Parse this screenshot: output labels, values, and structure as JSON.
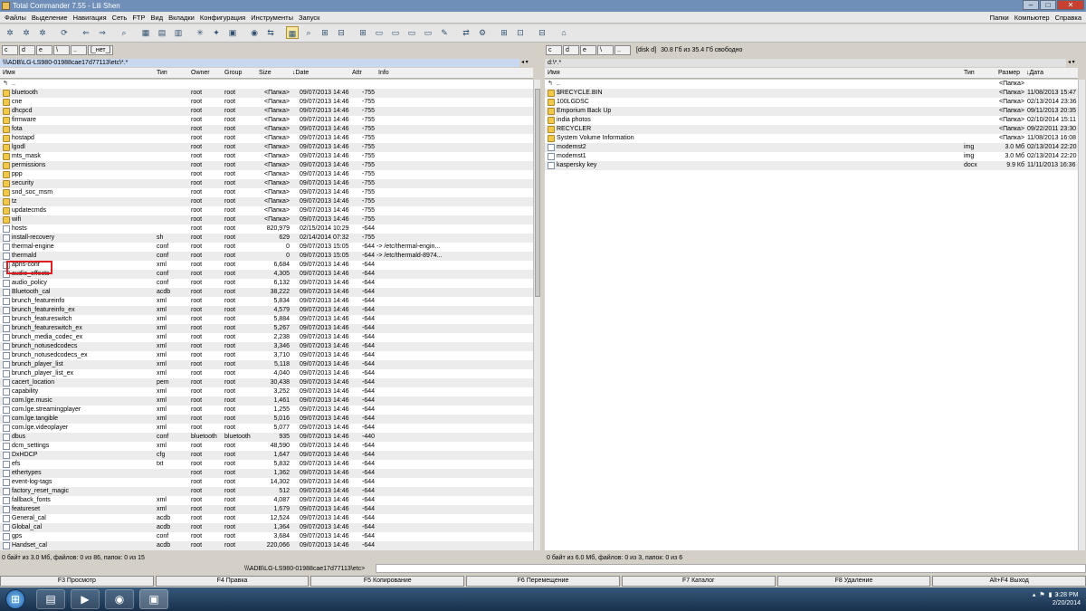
{
  "window": {
    "title": "Total Commander 7.55 - Lili Shen"
  },
  "menu": {
    "left": [
      "Файлы",
      "Выделение",
      "Навигация",
      "Сеть",
      "FTP",
      "Вид",
      "Вкладки",
      "Конфигурация",
      "Инструменты",
      "Запуск"
    ],
    "right": [
      "Папки",
      "Компьютер",
      "Справка"
    ]
  },
  "left": {
    "drives": [
      "c",
      "d",
      "e",
      "\\",
      "..",
      "[_нет_]"
    ],
    "path": "\\\\\\ADB\\LG-LS980-01988cae17d77113\\etc\\*.*",
    "headers": [
      "Имя",
      "Тип",
      "Owner",
      "Group",
      "Size",
      "Date",
      "Attr",
      "Info"
    ],
    "rows": [
      {
        "name": "..",
        "t": "",
        "o": "",
        "g": "",
        "s": "",
        "d": "",
        "a": "",
        "i": "",
        "k": "up"
      },
      {
        "name": "bluetooth",
        "t": "",
        "o": "root",
        "g": "root",
        "s": "<Папка>",
        "d": "09/07/2013 14:46",
        "a": "-755",
        "i": "",
        "k": "folder"
      },
      {
        "name": "cne",
        "t": "",
        "o": "root",
        "g": "root",
        "s": "<Папка>",
        "d": "09/07/2013 14:46",
        "a": "-755",
        "i": "",
        "k": "folder"
      },
      {
        "name": "dhcpcd",
        "t": "",
        "o": "root",
        "g": "root",
        "s": "<Папка>",
        "d": "09/07/2013 14:46",
        "a": "-755",
        "i": "",
        "k": "folder"
      },
      {
        "name": "firmware",
        "t": "",
        "o": "root",
        "g": "root",
        "s": "<Папка>",
        "d": "09/07/2013 14:46",
        "a": "-755",
        "i": "",
        "k": "folder"
      },
      {
        "name": "fota",
        "t": "",
        "o": "root",
        "g": "root",
        "s": "<Папка>",
        "d": "09/07/2013 14:46",
        "a": "-755",
        "i": "",
        "k": "folder"
      },
      {
        "name": "hostapd",
        "t": "",
        "o": "root",
        "g": "root",
        "s": "<Папка>",
        "d": "09/07/2013 14:46",
        "a": "-755",
        "i": "",
        "k": "folder"
      },
      {
        "name": "lgodl",
        "t": "",
        "o": "root",
        "g": "root",
        "s": "<Папка>",
        "d": "09/07/2013 14:46",
        "a": "-755",
        "i": "",
        "k": "folder"
      },
      {
        "name": "mts_mask",
        "t": "",
        "o": "root",
        "g": "root",
        "s": "<Папка>",
        "d": "09/07/2013 14:46",
        "a": "-755",
        "i": "",
        "k": "folder"
      },
      {
        "name": "permissions",
        "t": "",
        "o": "root",
        "g": "root",
        "s": "<Папка>",
        "d": "09/07/2013 14:46",
        "a": "-755",
        "i": "",
        "k": "folder"
      },
      {
        "name": "ppp",
        "t": "",
        "o": "root",
        "g": "root",
        "s": "<Папка>",
        "d": "09/07/2013 14:46",
        "a": "-755",
        "i": "",
        "k": "folder"
      },
      {
        "name": "security",
        "t": "",
        "o": "root",
        "g": "root",
        "s": "<Папка>",
        "d": "09/07/2013 14:46",
        "a": "-755",
        "i": "",
        "k": "folder"
      },
      {
        "name": "snd_soc_msm",
        "t": "",
        "o": "root",
        "g": "root",
        "s": "<Папка>",
        "d": "09/07/2013 14:46",
        "a": "-755",
        "i": "",
        "k": "folder"
      },
      {
        "name": "tz",
        "t": "",
        "o": "root",
        "g": "root",
        "s": "<Папка>",
        "d": "09/07/2013 14:46",
        "a": "-755",
        "i": "",
        "k": "folder"
      },
      {
        "name": "updatecmds",
        "t": "",
        "o": "root",
        "g": "root",
        "s": "<Папка>",
        "d": "09/07/2013 14:46",
        "a": "-755",
        "i": "",
        "k": "folder"
      },
      {
        "name": "wifi",
        "t": "",
        "o": "root",
        "g": "root",
        "s": "<Папка>",
        "d": "09/07/2013 14:46",
        "a": "-755",
        "i": "",
        "k": "folder"
      },
      {
        "name": "hosts",
        "t": "",
        "o": "root",
        "g": "root",
        "s": "820,979",
        "d": "02/15/2014 10:29",
        "a": "-644",
        "i": "",
        "k": "file"
      },
      {
        "name": "install-recovery",
        "t": "sh",
        "o": "root",
        "g": "root",
        "s": "629",
        "d": "02/14/2014 07:32",
        "a": "-755",
        "i": "",
        "k": "file"
      },
      {
        "name": "thermal-engine",
        "t": "conf",
        "o": "root",
        "g": "root",
        "s": "0",
        "d": "09/07/2013 15:05",
        "a": "-644",
        "i": "-> /etc/thermal-engin...",
        "k": "file"
      },
      {
        "name": "thermald",
        "t": "conf",
        "o": "root",
        "g": "root",
        "s": "0",
        "d": "09/07/2013 15:05",
        "a": "-644",
        "i": "-> /etc/thermald-8974...",
        "k": "file"
      },
      {
        "name": "apns-conf",
        "t": "xml",
        "o": "root",
        "g": "root",
        "s": "6,684",
        "d": "09/07/2013 14:46",
        "a": "-644",
        "i": "",
        "k": "file"
      },
      {
        "name": "audio_effects",
        "t": "conf",
        "o": "root",
        "g": "root",
        "s": "4,305",
        "d": "09/07/2013 14:46",
        "a": "-644",
        "i": "",
        "k": "file"
      },
      {
        "name": "audio_policy",
        "t": "conf",
        "o": "root",
        "g": "root",
        "s": "6,132",
        "d": "09/07/2013 14:46",
        "a": "-644",
        "i": "",
        "k": "file"
      },
      {
        "name": "Bluetooth_cal",
        "t": "acdb",
        "o": "root",
        "g": "root",
        "s": "38,222",
        "d": "09/07/2013 14:46",
        "a": "-644",
        "i": "",
        "k": "file"
      },
      {
        "name": "brunch_featureinfo",
        "t": "xml",
        "o": "root",
        "g": "root",
        "s": "5,834",
        "d": "09/07/2013 14:46",
        "a": "-644",
        "i": "",
        "k": "file"
      },
      {
        "name": "brunch_featureinfo_ex",
        "t": "xml",
        "o": "root",
        "g": "root",
        "s": "4,579",
        "d": "09/07/2013 14:46",
        "a": "-644",
        "i": "",
        "k": "file"
      },
      {
        "name": "brunch_featureswitch",
        "t": "xml",
        "o": "root",
        "g": "root",
        "s": "5,884",
        "d": "09/07/2013 14:46",
        "a": "-644",
        "i": "",
        "k": "file"
      },
      {
        "name": "brunch_featureswitch_ex",
        "t": "xml",
        "o": "root",
        "g": "root",
        "s": "5,267",
        "d": "09/07/2013 14:46",
        "a": "-644",
        "i": "",
        "k": "file"
      },
      {
        "name": "brunch_media_codec_ex",
        "t": "xml",
        "o": "root",
        "g": "root",
        "s": "2,238",
        "d": "09/07/2013 14:46",
        "a": "-644",
        "i": "",
        "k": "file"
      },
      {
        "name": "brunch_notusedcodecs",
        "t": "xml",
        "o": "root",
        "g": "root",
        "s": "3,346",
        "d": "09/07/2013 14:46",
        "a": "-644",
        "i": "",
        "k": "file"
      },
      {
        "name": "brunch_notusedcodecs_ex",
        "t": "xml",
        "o": "root",
        "g": "root",
        "s": "3,710",
        "d": "09/07/2013 14:46",
        "a": "-644",
        "i": "",
        "k": "file"
      },
      {
        "name": "brunch_player_list",
        "t": "xml",
        "o": "root",
        "g": "root",
        "s": "5,118",
        "d": "09/07/2013 14:46",
        "a": "-644",
        "i": "",
        "k": "file"
      },
      {
        "name": "brunch_player_list_ex",
        "t": "xml",
        "o": "root",
        "g": "root",
        "s": "4,040",
        "d": "09/07/2013 14:46",
        "a": "-644",
        "i": "",
        "k": "file"
      },
      {
        "name": "cacert_location",
        "t": "pem",
        "o": "root",
        "g": "root",
        "s": "30,438",
        "d": "09/07/2013 14:46",
        "a": "-644",
        "i": "",
        "k": "file"
      },
      {
        "name": "capability",
        "t": "xml",
        "o": "root",
        "g": "root",
        "s": "3,252",
        "d": "09/07/2013 14:46",
        "a": "-644",
        "i": "",
        "k": "file"
      },
      {
        "name": "com.lge.music",
        "t": "xml",
        "o": "root",
        "g": "root",
        "s": "1,461",
        "d": "09/07/2013 14:46",
        "a": "-644",
        "i": "",
        "k": "file"
      },
      {
        "name": "com.lge.streamingplayer",
        "t": "xml",
        "o": "root",
        "g": "root",
        "s": "1,255",
        "d": "09/07/2013 14:46",
        "a": "-644",
        "i": "",
        "k": "file"
      },
      {
        "name": "com.lge.tangible",
        "t": "xml",
        "o": "root",
        "g": "root",
        "s": "5,016",
        "d": "09/07/2013 14:46",
        "a": "-644",
        "i": "",
        "k": "file"
      },
      {
        "name": "com.lge.videoplayer",
        "t": "xml",
        "o": "root",
        "g": "root",
        "s": "5,077",
        "d": "09/07/2013 14:46",
        "a": "-644",
        "i": "",
        "k": "file"
      },
      {
        "name": "dbus",
        "t": "conf",
        "o": "bluetooth",
        "g": "bluetooth",
        "s": "935",
        "d": "09/07/2013 14:46",
        "a": "-440",
        "i": "",
        "k": "file"
      },
      {
        "name": "dcm_settings",
        "t": "xml",
        "o": "root",
        "g": "root",
        "s": "48,590",
        "d": "09/07/2013 14:46",
        "a": "-644",
        "i": "",
        "k": "file"
      },
      {
        "name": "DxHDCP",
        "t": "cfg",
        "o": "root",
        "g": "root",
        "s": "1,647",
        "d": "09/07/2013 14:46",
        "a": "-644",
        "i": "",
        "k": "file"
      },
      {
        "name": "efs",
        "t": "txt",
        "o": "root",
        "g": "root",
        "s": "5,832",
        "d": "09/07/2013 14:46",
        "a": "-644",
        "i": "",
        "k": "file"
      },
      {
        "name": "ethertypes",
        "t": "",
        "o": "root",
        "g": "root",
        "s": "1,362",
        "d": "09/07/2013 14:46",
        "a": "-644",
        "i": "",
        "k": "file"
      },
      {
        "name": "event-log-tags",
        "t": "",
        "o": "root",
        "g": "root",
        "s": "14,302",
        "d": "09/07/2013 14:46",
        "a": "-644",
        "i": "",
        "k": "file"
      },
      {
        "name": "factory_reset_magic",
        "t": "",
        "o": "root",
        "g": "root",
        "s": "512",
        "d": "09/07/2013 14:46",
        "a": "-644",
        "i": "",
        "k": "file"
      },
      {
        "name": "fallback_fonts",
        "t": "xml",
        "o": "root",
        "g": "root",
        "s": "4,087",
        "d": "09/07/2013 14:46",
        "a": "-644",
        "i": "",
        "k": "file"
      },
      {
        "name": "featureset",
        "t": "xml",
        "o": "root",
        "g": "root",
        "s": "1,679",
        "d": "09/07/2013 14:46",
        "a": "-644",
        "i": "",
        "k": "file"
      },
      {
        "name": "General_cal",
        "t": "acdb",
        "o": "root",
        "g": "root",
        "s": "12,524",
        "d": "09/07/2013 14:46",
        "a": "-644",
        "i": "",
        "k": "file"
      },
      {
        "name": "Global_cal",
        "t": "acdb",
        "o": "root",
        "g": "root",
        "s": "1,364",
        "d": "09/07/2013 14:46",
        "a": "-644",
        "i": "",
        "k": "file"
      },
      {
        "name": "gps",
        "t": "conf",
        "o": "root",
        "g": "root",
        "s": "3,684",
        "d": "09/07/2013 14:46",
        "a": "-644",
        "i": "",
        "k": "file"
      },
      {
        "name": "Handset_cal",
        "t": "acdb",
        "o": "root",
        "g": "root",
        "s": "220,066",
        "d": "09/07/2013 14:46",
        "a": "-644",
        "i": "",
        "k": "file"
      }
    ],
    "status": "0 байт из 3.0 Мб, файлов: 0 из 86, папок: 0 из 15"
  },
  "right": {
    "drives": [
      "c",
      "d",
      "e",
      "\\",
      ".."
    ],
    "disk_label": "[disk d]",
    "disk_info": "30.8 Гб из 35.4 Гб свободно",
    "path": "d:\\*.*",
    "headers": [
      "Имя",
      "Тип",
      "Размер",
      "Дата"
    ],
    "rows": [
      {
        "name": "..",
        "t": "",
        "s": "<Папка>",
        "d": "",
        "k": "up"
      },
      {
        "name": "$RECYCLE.BIN",
        "t": "",
        "s": "<Папка>",
        "d": "11/08/2013 15:47",
        "k": "folder"
      },
      {
        "name": "100LGDSC",
        "t": "",
        "s": "<Папка>",
        "d": "02/13/2014 23:36",
        "k": "folder"
      },
      {
        "name": "Emporium Back Up",
        "t": "",
        "s": "<Папка>",
        "d": "09/11/2013 20:35",
        "k": "folder"
      },
      {
        "name": "india photos",
        "t": "",
        "s": "<Папка>",
        "d": "02/10/2014 15:11",
        "k": "folder"
      },
      {
        "name": "RECYCLER",
        "t": "",
        "s": "<Папка>",
        "d": "09/22/2011 23:30",
        "k": "folder"
      },
      {
        "name": "System Volume Information",
        "t": "",
        "s": "<Папка>",
        "d": "11/08/2013 16:08",
        "k": "folder"
      },
      {
        "name": "modemst2",
        "t": "img",
        "s": "3.0 Мб",
        "d": "02/13/2014 22:20",
        "k": "file"
      },
      {
        "name": "modemst1",
        "t": "img",
        "s": "3.0 Мб",
        "d": "02/13/2014 22:20",
        "k": "file"
      },
      {
        "name": "kaspersky key",
        "t": "docx",
        "s": "9.9 Кб",
        "d": "11/11/2013 16:36",
        "k": "file"
      }
    ],
    "status": "0 байт из 6.0 Мб, файлов: 0 из 3, папок: 0 из 6"
  },
  "cmdline": {
    "path": "\\\\\\ADB\\LG-LS980-01988cae17d77113\\etc>"
  },
  "fkeys": [
    "F3 Просмотр",
    "F4 Правка",
    "F5 Копирование",
    "F6 Перемещение",
    "F7 Каталог",
    "F8 Удаление",
    "Alt+F4 Выход"
  ],
  "taskbar": {
    "time": "3:28 PM",
    "date": "2/20/2014"
  }
}
